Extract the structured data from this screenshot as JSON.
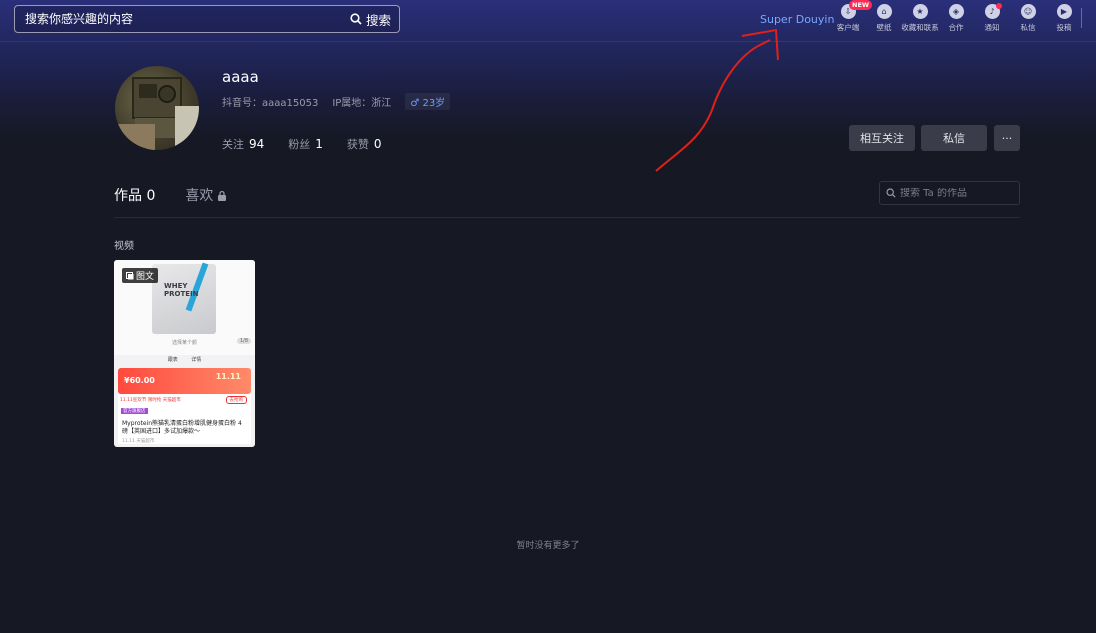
{
  "search": {
    "placeholder": "搜索你感兴趣的内容",
    "button_label": "搜索"
  },
  "header": {
    "super_douyin": "Super Douyin",
    "nav_items": [
      {
        "label": "客户端",
        "icon": "download-icon",
        "badge": "NEW"
      },
      {
        "label": "壁纸",
        "icon": "home-icon"
      },
      {
        "label": "收藏和联系",
        "icon": "star-icon"
      },
      {
        "label": "合作",
        "icon": "cube-icon"
      },
      {
        "label": "通知",
        "icon": "bell-icon"
      },
      {
        "label": "私信",
        "icon": "message-icon"
      },
      {
        "label": "投稿",
        "icon": "video-icon"
      }
    ]
  },
  "profile": {
    "username": "aaaa",
    "douyin_id": "抖音号：aaaa15053",
    "ip_location": "IP属地：浙江",
    "age": "♂ 23岁",
    "stats": [
      {
        "label": "关注",
        "value": "94"
      },
      {
        "label": "粉丝",
        "value": "1"
      },
      {
        "label": "获赞",
        "value": "0"
      }
    ],
    "buttons": {
      "follow_back": "相互关注",
      "message": "私信",
      "more": "···"
    }
  },
  "tabs": {
    "works_label": "作品",
    "works_count": "0",
    "likes_label": "喜欢"
  },
  "work_search": {
    "placeholder": "搜索 Ta 的作品"
  },
  "section_label": "视频",
  "video_card": {
    "tag": "图文",
    "caption": "选择某个颜",
    "count": "1/8",
    "tabs": [
      "跟表",
      "详情"
    ],
    "price": "¥60.00",
    "price_right": "11.11",
    "promo": "11.11狂欢节 限时抢 天猫超市",
    "promo_button": "去抢购",
    "purple_tag": "官方旗舰店",
    "title": "Myprotein熊猫乳清蛋白粉增肌健身蛋白粉 4磅【英国进口】多试加爆款～",
    "bottom": "11.11 天猫超市"
  },
  "end_text": "暂时没有更多了",
  "colors": {
    "accent_blue": "#7aa7ff",
    "badge_red": "#fe2c55",
    "annotation_red": "#e0201a"
  }
}
